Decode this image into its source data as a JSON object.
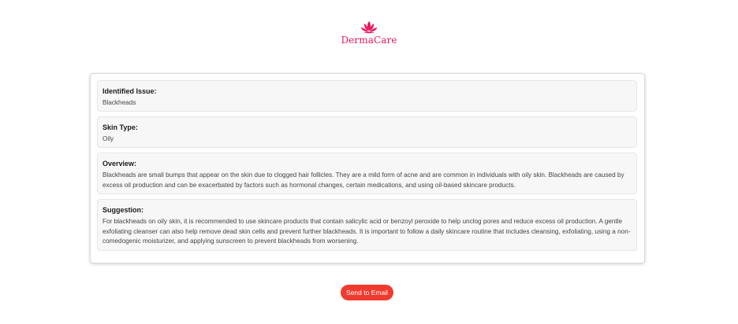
{
  "brand": {
    "name": "DermaCare",
    "icon": "lotus-icon",
    "color": "#e5175e"
  },
  "result": {
    "issue": {
      "heading": "Identified Issue:",
      "value": "Blackheads"
    },
    "skin_type": {
      "heading": "Skin Type:",
      "value": "Oily"
    },
    "overview": {
      "heading": "Overview:",
      "text": "Blackheads are small bumps that appear on the skin due to clogged hair follicles. They are a mild form of acne and are common in individuals with oily skin. Blackheads are caused by excess oil production and can be exacerbated by factors such as hormonal changes, certain medications, and using oil-based skincare products."
    },
    "suggestion": {
      "heading": "Suggestion:",
      "text": "For blackheads on oily skin, it is recommended to use skincare products that contain salicylic acid or benzoyl peroxide to help unclog pores and reduce excess oil production. A gentle exfoliating cleanser can also help remove dead skin cells and prevent further blackheads. It is important to follow a daily skincare routine that includes cleansing, exfoliating, using a non-comedogenic moisturizer, and applying sunscreen to prevent blackheads from worsening."
    }
  },
  "actions": {
    "send_email_label": "Send to Email",
    "button_color": "#ef3b2f"
  }
}
